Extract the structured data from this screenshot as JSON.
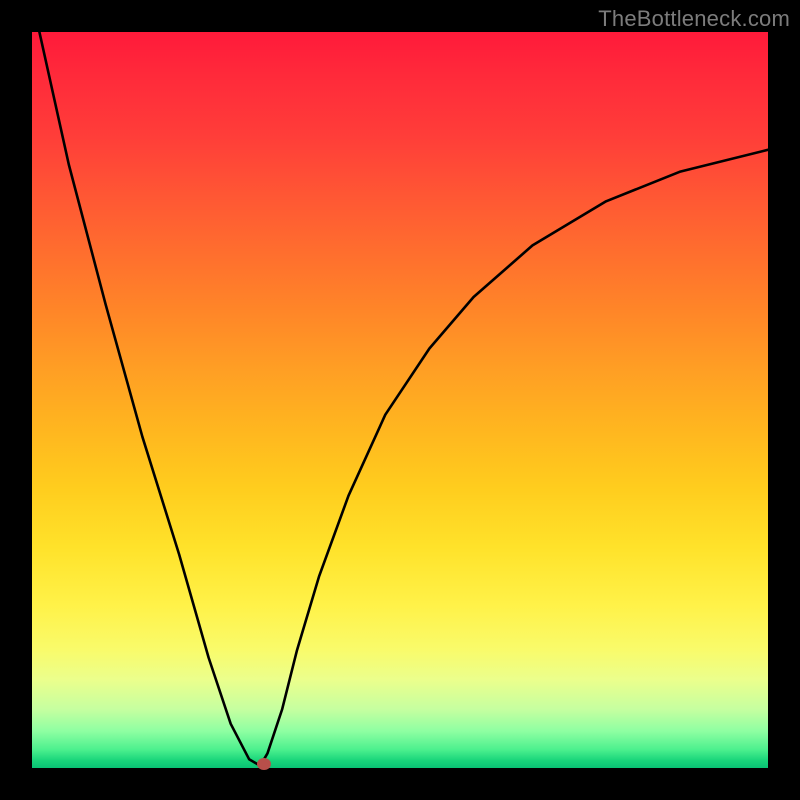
{
  "watermark": "TheBottleneck.com",
  "chart_data": {
    "type": "line",
    "title": "",
    "xlabel": "",
    "ylabel": "",
    "xlim": [
      0,
      100
    ],
    "ylim": [
      0,
      100
    ],
    "grid": false,
    "legend": false,
    "background_gradient": {
      "direction": "vertical",
      "stops": [
        {
          "pos": 0,
          "color": "#ff1a3a"
        },
        {
          "pos": 50,
          "color": "#ffb61f"
        },
        {
          "pos": 80,
          "color": "#fff249"
        },
        {
          "pos": 100,
          "color": "#09c274"
        }
      ]
    },
    "series": [
      {
        "name": "bottleneck-curve",
        "x": [
          1,
          5,
          10,
          15,
          20,
          24,
          27,
          29.5,
          31,
          32,
          34,
          36,
          39,
          43,
          48,
          54,
          60,
          68,
          78,
          88,
          100
        ],
        "y": [
          100,
          82,
          63,
          45,
          29,
          15,
          6,
          1.2,
          0.3,
          2,
          8,
          16,
          26,
          37,
          48,
          57,
          64,
          71,
          77,
          81,
          84
        ]
      }
    ],
    "marker": {
      "x": 31.5,
      "y": 0.6,
      "color": "#b84f4a"
    }
  }
}
